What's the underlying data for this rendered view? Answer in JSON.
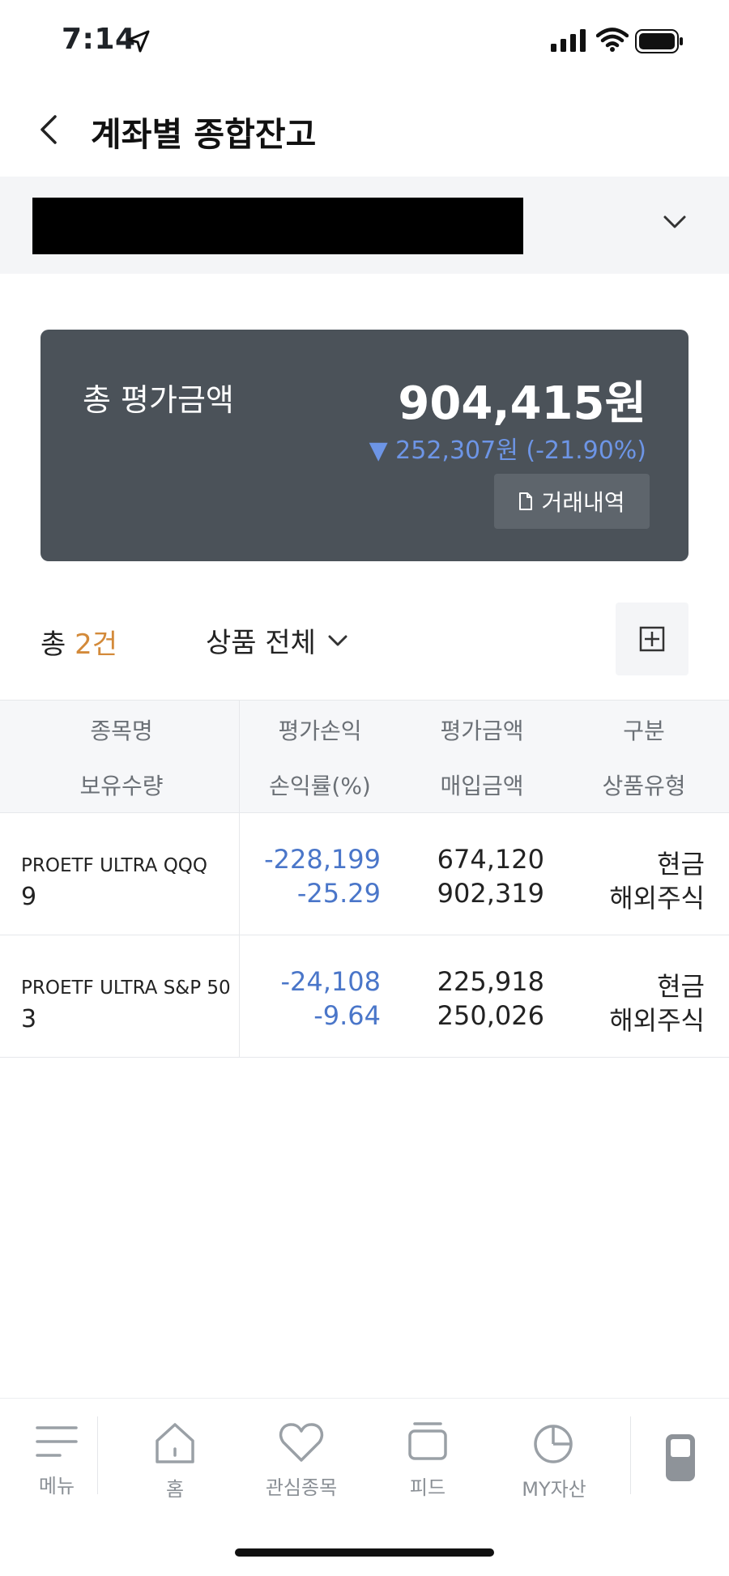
{
  "status_bar": {
    "time": "7:14"
  },
  "header": {
    "title": "계좌별 종합잔고"
  },
  "summary": {
    "total_label": "총 평가금액",
    "total_value": "904,415원",
    "change_text": "▼ 252,307원 (-21.90%)",
    "history_button_label": "거래내역",
    "change_color": "#6d95e6"
  },
  "filter": {
    "count_prefix": "총 ",
    "count_value": "2건",
    "product_filter_label": "상품 전체"
  },
  "table": {
    "headers_row1": [
      "종목명",
      "평가손익",
      "평가금액",
      "구분"
    ],
    "headers_row2": [
      "보유수량",
      "손익률(%)",
      "매입금액",
      "상품유형"
    ],
    "rows": [
      {
        "name": "PROETF ULTRA QQQ",
        "quantity": "9",
        "profit_loss": "-228,199",
        "return_rate": "-25.29",
        "eval_amount": "674,120",
        "purchase_amount": "902,319",
        "category": "현금",
        "product_type": "해외주식"
      },
      {
        "name": "PROETF ULTRA S&P 50",
        "quantity": "3",
        "profit_loss": "-24,108",
        "return_rate": "-9.64",
        "eval_amount": "225,918",
        "purchase_amount": "250,026",
        "category": "현금",
        "product_type": "해외주식"
      }
    ]
  },
  "bottom_nav": {
    "items": [
      {
        "label": "메뉴",
        "icon": "menu-icon"
      },
      {
        "label": "홈",
        "icon": "home-icon"
      },
      {
        "label": "관심종목",
        "icon": "heart-icon"
      },
      {
        "label": "피드",
        "icon": "feed-icon"
      },
      {
        "label": "MY자산",
        "icon": "pie-chart-icon"
      }
    ]
  }
}
